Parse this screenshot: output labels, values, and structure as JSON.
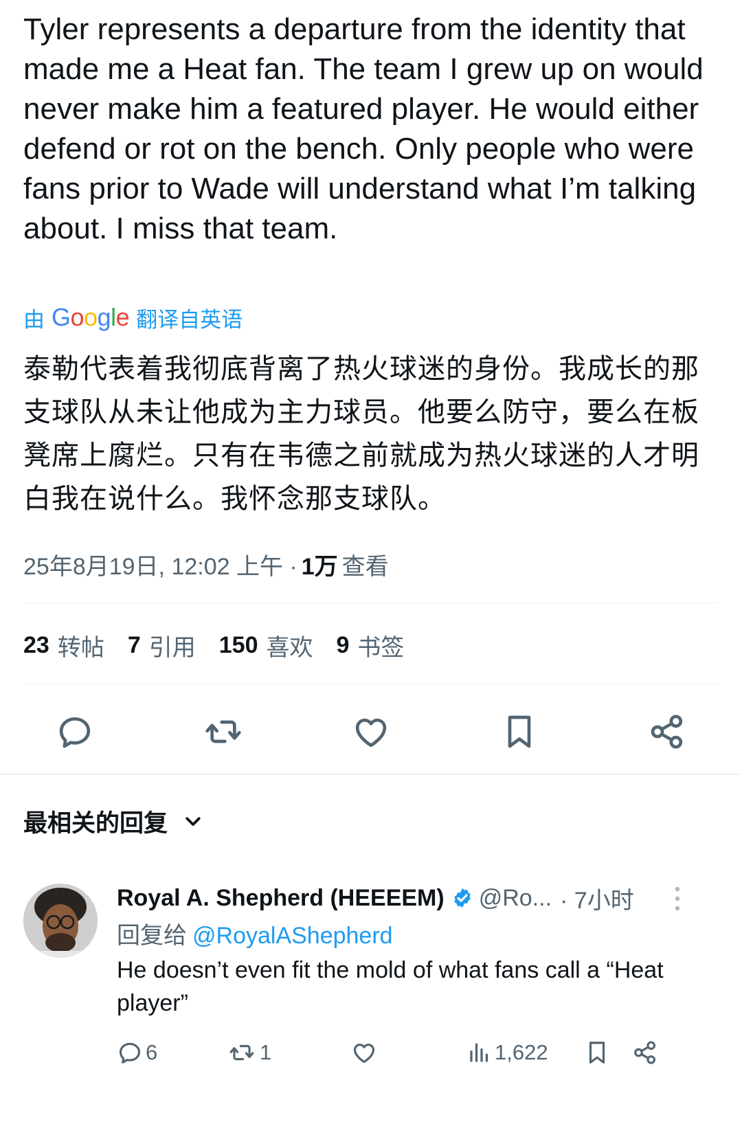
{
  "tweet": {
    "text": "Tyler represents a departure from the identity that made me a Heat fan. The team I grew up on would never make him a featured player. He would either defend or rot on the bench. Only people who were fans prior to Wade will understand what I’m talking about. I miss that team.",
    "translate_prefix": "由",
    "translate_brand": "Google",
    "translate_suffix": "翻译自英语",
    "translated_text": "泰勒代表着我彻底背离了热火球迷的身份。我成长的那支球队从未让他成为主力球员。他要么防守，要么在板凳席上腐烂。只有在韦德之前就成为热火球迷的人才明白我在说什么。我怀念那支球队。",
    "timestamp": "25年8月19日, 12:02 上午 ·",
    "views_count": "1万",
    "views_label": "查看"
  },
  "stats": {
    "reposts_count": "23",
    "reposts_label": "转帖",
    "quotes_count": "7",
    "quotes_label": "引用",
    "likes_count": "150",
    "likes_label": "喜欢",
    "bookmarks_count": "9",
    "bookmarks_label": "书签"
  },
  "actions": {
    "icons": [
      "reply-icon",
      "repost-icon",
      "like-icon",
      "bookmark-icon",
      "share-icon"
    ]
  },
  "replies_header": {
    "label": "最相关的回复"
  },
  "reply": {
    "name": "Royal A. Shepherd (HEEEEM)",
    "handle": "@Ro...",
    "time": "· 7小时",
    "reply_to_label": "回复给",
    "reply_to_handle": "@RoyalAShepherd",
    "text": "He doesn’t even fit the mold of what fans call a “Heat player”",
    "reply_count": "6",
    "repost_count": "1",
    "views_count": "1,622"
  },
  "colors": {
    "accent": "#1d9bf0",
    "text_primary": "#0f1419",
    "text_secondary": "#536471",
    "divider": "#eff3f4"
  }
}
